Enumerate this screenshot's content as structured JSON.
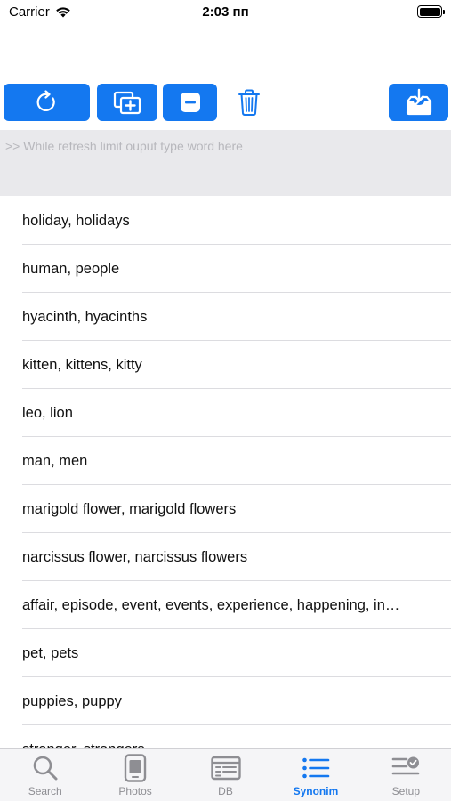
{
  "status_bar": {
    "carrier": "Carrier",
    "time": "2:03 пп"
  },
  "toolbar": {
    "refresh_icon": "refresh-icon",
    "add_icon": "add-copy-icon",
    "remove_icon": "minus-icon",
    "trash_icon": "trash-icon",
    "download_icon": "download-tray-icon",
    "accent_color": "#1478f0"
  },
  "search": {
    "value": "",
    "placeholder": ">> While refresh limit ouput type word here"
  },
  "synonyms": [
    "holiday, holidays",
    "human, people",
    "hyacinth, hyacinths",
    "kitten, kittens, kitty",
    "leo, lion",
    "man, men",
    "marigold flower, marigold flowers",
    "narcissus flower, narcissus flowers",
    "affair, episode, event, events, experience, happening, in…",
    "pet, pets",
    "puppies, puppy",
    "stranger, strangers"
  ],
  "tabbar": {
    "tabs": [
      {
        "label": "Search",
        "icon": "search-icon"
      },
      {
        "label": "Photos",
        "icon": "photos-icon"
      },
      {
        "label": "DB",
        "icon": "db-icon"
      },
      {
        "label": "Synonim",
        "icon": "list-icon",
        "active": true
      },
      {
        "label": "Setup",
        "icon": "setup-icon"
      }
    ]
  }
}
